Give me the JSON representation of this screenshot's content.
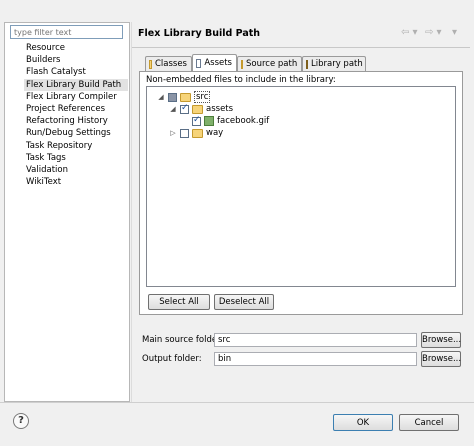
{
  "filter": {
    "placeholder": "type filter text"
  },
  "sidebar": {
    "items": [
      {
        "label": "Resource"
      },
      {
        "label": "Builders"
      },
      {
        "label": "Flash Catalyst"
      },
      {
        "label": "Flex Library Build Path"
      },
      {
        "label": "Flex Library Compiler"
      },
      {
        "label": "Project References"
      },
      {
        "label": "Refactoring History"
      },
      {
        "label": "Run/Debug Settings"
      },
      {
        "label": "Task Repository"
      },
      {
        "label": "Task Tags"
      },
      {
        "label": "Validation"
      },
      {
        "label": "WikiText"
      }
    ],
    "selected_index": 3
  },
  "header": {
    "title": "Flex Library Build Path",
    "back_glyph": "⇦ ▾",
    "forward_glyph": "⇨ ▾",
    "menu_glyph": "▾"
  },
  "tabs": [
    {
      "label": "Classes",
      "active": false
    },
    {
      "label": "Assets",
      "active": true
    },
    {
      "label": "Source path",
      "active": false
    },
    {
      "label": "Library path",
      "active": false
    }
  ],
  "assets": {
    "description": "Non-embedded files to include in the library:",
    "tree": {
      "root": {
        "label": "src",
        "twisty": "◢"
      },
      "assets_folder": {
        "label": "assets",
        "twisty": "◢"
      },
      "file": {
        "label": "facebook.gif"
      },
      "way_folder": {
        "label": "way",
        "twisty": "▷"
      }
    },
    "select_all_label": "Select All",
    "deselect_all_label": "Deselect All"
  },
  "fields": {
    "main_source": {
      "label": "Main source folder:",
      "value": "src",
      "browse_label": "Browse..."
    },
    "output": {
      "label": "Output folder:",
      "value": "bin",
      "browse_label": "Browse..."
    }
  },
  "footer": {
    "help_glyph": "?",
    "ok_label": "OK",
    "cancel_label": "Cancel"
  }
}
